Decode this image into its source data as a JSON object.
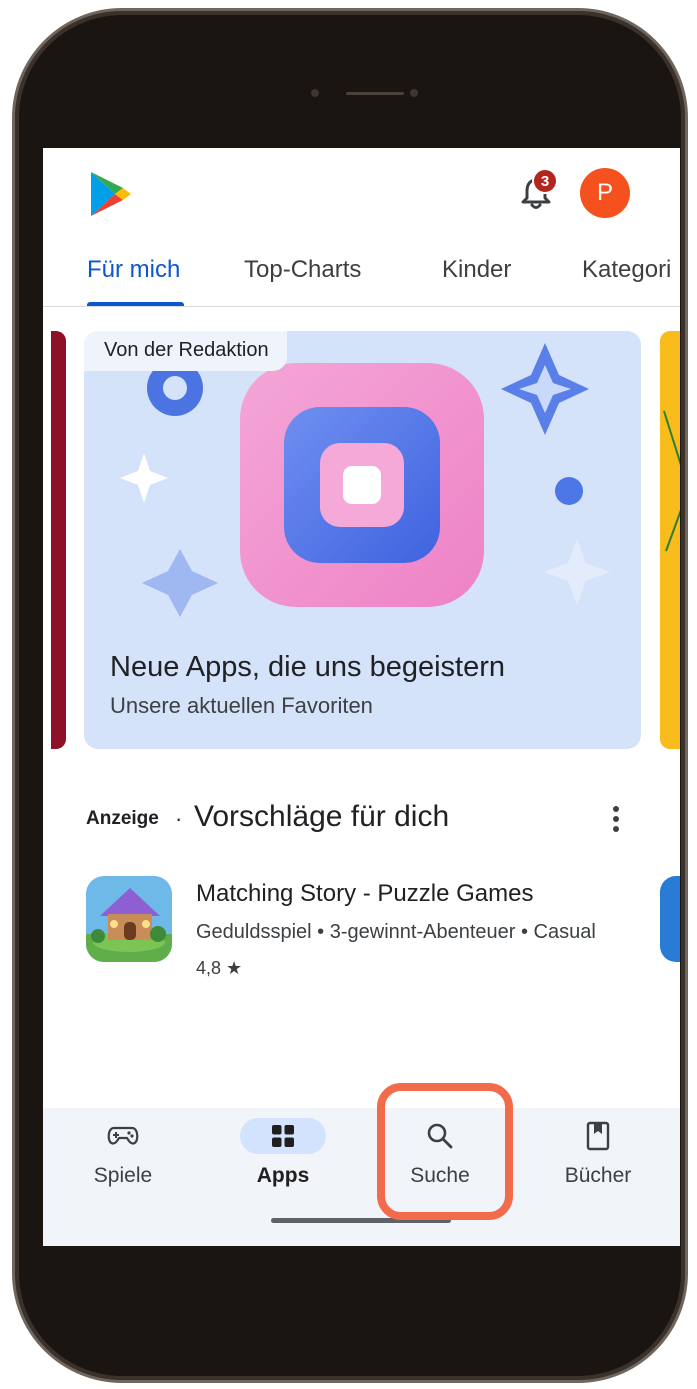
{
  "header": {
    "notification_count": "3",
    "avatar_initial": "P"
  },
  "tabs": [
    {
      "label": "Für mich",
      "active": true
    },
    {
      "label": "Top-Charts",
      "active": false
    },
    {
      "label": "Kinder",
      "active": false
    },
    {
      "label": "Kategori",
      "active": false
    }
  ],
  "featured": {
    "label": "Von der Redaktion",
    "title": "Neue Apps, die uns begeistern",
    "subtitle": "Unsere aktuellen Favoriten"
  },
  "section": {
    "ad_label": "Anzeige",
    "separator": "·",
    "title": "Vorschläge für dich"
  },
  "app": {
    "name": "Matching Story - Puzzle Games",
    "tags": "Geduldsspiel • 3-gewinnt-Abenteuer • Casual",
    "rating": "4,8 ★"
  },
  "bottom_nav": [
    {
      "label": "Spiele",
      "icon": "gamepad-icon",
      "active": false
    },
    {
      "label": "Apps",
      "icon": "apps-grid-icon",
      "active": true
    },
    {
      "label": "Suche",
      "icon": "search-icon",
      "active": false
    },
    {
      "label": "Bücher",
      "icon": "bookmark-book-icon",
      "active": false
    }
  ],
  "colors": {
    "accent": "#0b57d0",
    "highlight": "#f26b4b",
    "badge": "#b3261e",
    "avatar": "#f4511e"
  }
}
